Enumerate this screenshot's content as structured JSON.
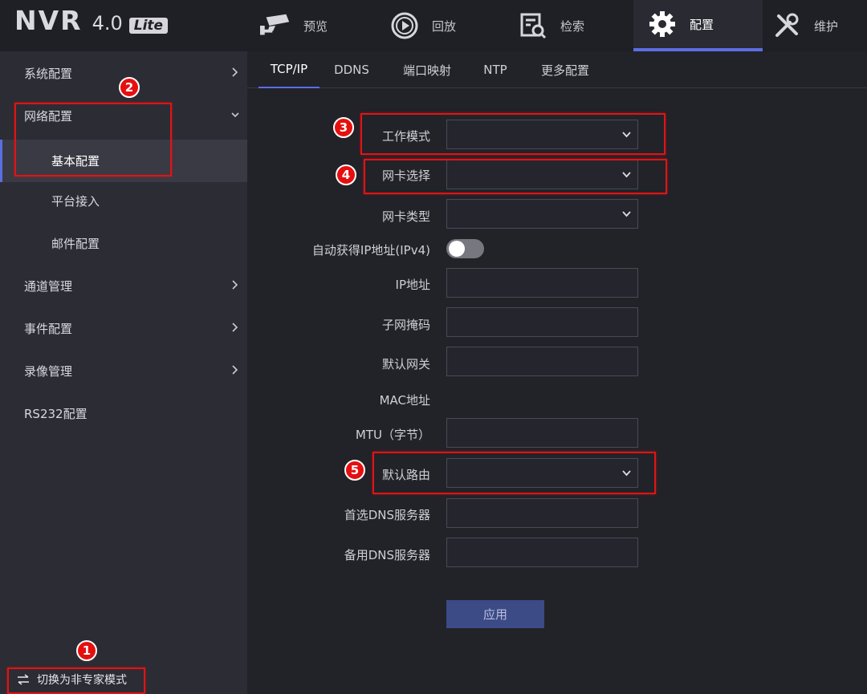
{
  "logo": {
    "name": "NVR",
    "version": "4.0",
    "edition": "Lite"
  },
  "nav": [
    {
      "label": "预览",
      "icon": "camera-icon"
    },
    {
      "label": "回放",
      "icon": "playback-icon"
    },
    {
      "label": "检索",
      "icon": "search-files-icon"
    },
    {
      "label": "配置",
      "icon": "gear-icon",
      "active": true
    },
    {
      "label": "维护",
      "icon": "tools-icon"
    }
  ],
  "sidebar": {
    "items": [
      {
        "label": "系统配置"
      },
      {
        "label": "网络配置",
        "expanded": true
      },
      {
        "label": "基本配置",
        "selected": true
      },
      {
        "label": "平台接入"
      },
      {
        "label": "邮件配置"
      },
      {
        "label": "通道管理"
      },
      {
        "label": "事件配置"
      },
      {
        "label": "录像管理"
      },
      {
        "label": "RS232配置"
      }
    ],
    "switch_mode": "切换为非专家模式"
  },
  "tabs": [
    "TCP/IP",
    "DDNS",
    "端口映射",
    "NTP",
    "更多配置"
  ],
  "form": {
    "work_mode": "工作模式",
    "nic_select": "网卡选择",
    "nic_type": "网卡类型",
    "dhcp": "自动获得IP地址(IPv4)",
    "ip": "IP地址",
    "subnet": "子网掩码",
    "gateway": "默认网关",
    "mac": "MAC地址",
    "mtu": "MTU（字节）",
    "default_route": "默认路由",
    "dns_primary": "首选DNS服务器",
    "dns_backup": "备用DNS服务器",
    "apply": "应用",
    "dhcp_enabled": false
  },
  "annotations": [
    "1",
    "2",
    "3",
    "4",
    "5"
  ],
  "colors": {
    "accent": "#5b6ee1",
    "annotation": "#e01414",
    "apply_button": "#3c4a86"
  }
}
